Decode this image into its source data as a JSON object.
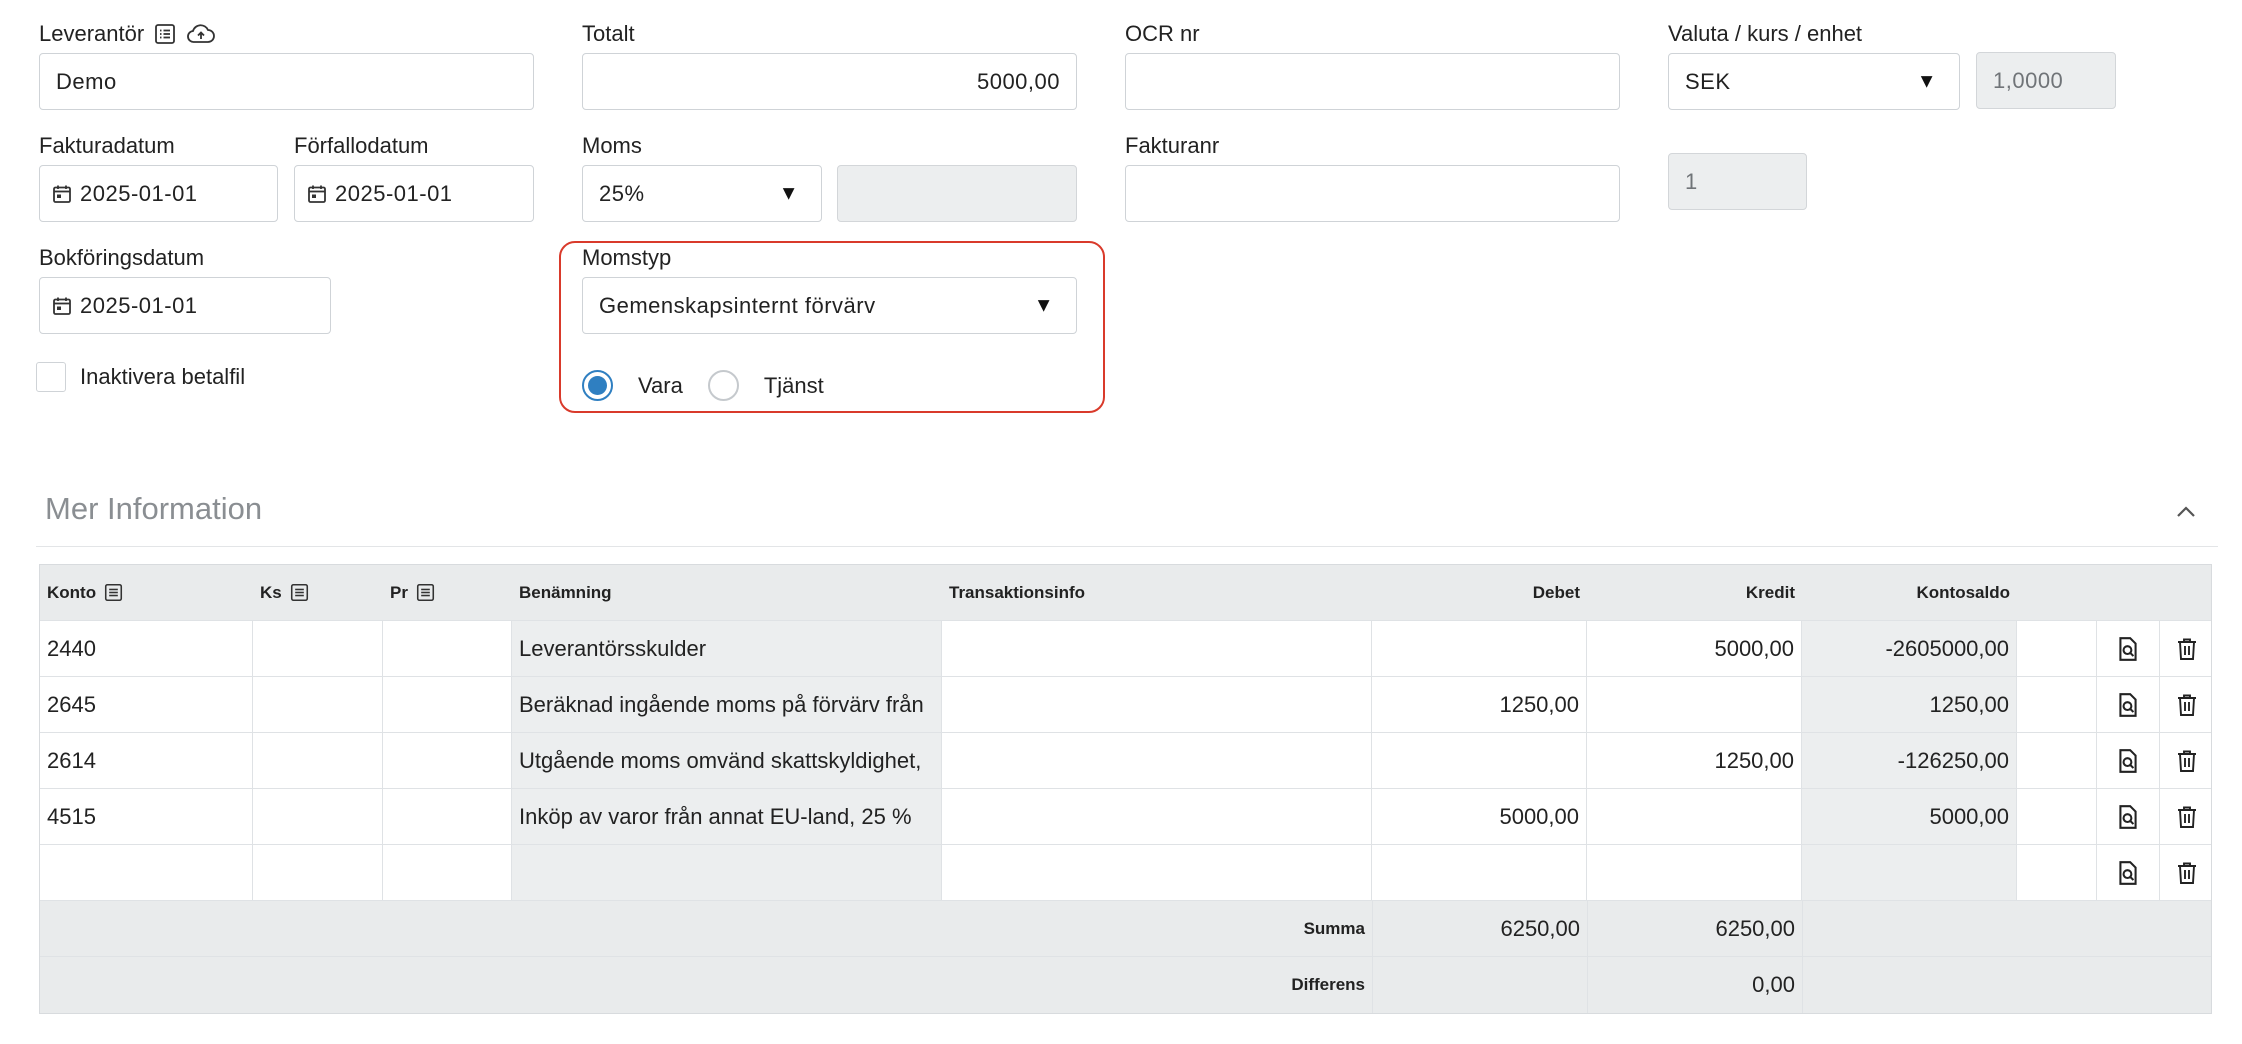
{
  "form": {
    "supplier": {
      "label": "Leverantör",
      "value": "Demo"
    },
    "total": {
      "label": "Totalt",
      "value": "5000,00"
    },
    "ocr": {
      "label": "OCR nr",
      "value": ""
    },
    "currency": {
      "label": "Valuta / kurs / enhet",
      "selected": "SEK",
      "rate": "1,0000",
      "unit": "1"
    },
    "invoice_date": {
      "label": "Fakturadatum",
      "value": "2025-01-01"
    },
    "due_date": {
      "label": "Förfallodatum",
      "value": "2025-01-01"
    },
    "vat": {
      "label": "Moms",
      "selected": "25%",
      "amount": ""
    },
    "invoice_no": {
      "label": "Fakturanr",
      "value": ""
    },
    "booking_date": {
      "label": "Bokföringsdatum",
      "value": "2025-01-01"
    },
    "vat_type": {
      "label": "Momstyp",
      "selected": "Gemenskapsinternt förvärv",
      "options": [
        "Vara",
        "Tjänst"
      ],
      "checked": "Vara"
    },
    "disable_payfile": {
      "label": "Inaktivera betalfil",
      "checked": false
    }
  },
  "more_info": {
    "title": "Mer Information"
  },
  "table": {
    "headers": [
      "Konto",
      "Ks",
      "Pr",
      "Benämning",
      "Transaktionsinfo",
      "Debet",
      "Kredit",
      "Kontosaldo"
    ],
    "rows": [
      {
        "konto": "2440",
        "ks": "",
        "pr": "",
        "benamning": "Leverantörsskulder",
        "info": "",
        "debet": "",
        "kredit": "5000,00",
        "saldo": "-2605000,00"
      },
      {
        "konto": "2645",
        "ks": "",
        "pr": "",
        "benamning": "Beräknad ingående moms på förvärv från",
        "info": "",
        "debet": "1250,00",
        "kredit": "",
        "saldo": "1250,00"
      },
      {
        "konto": "2614",
        "ks": "",
        "pr": "",
        "benamning": "Utgående moms omvänd skattskyldighet,",
        "info": "",
        "debet": "",
        "kredit": "1250,00",
        "saldo": "-126250,00"
      },
      {
        "konto": "4515",
        "ks": "",
        "pr": "",
        "benamning": "Inköp av varor från annat EU-land, 25 %",
        "info": "",
        "debet": "5000,00",
        "kredit": "",
        "saldo": "5000,00"
      },
      {
        "konto": "",
        "ks": "",
        "pr": "",
        "benamning": "",
        "info": "",
        "debet": "",
        "kredit": "",
        "saldo": ""
      }
    ],
    "summa": {
      "label": "Summa",
      "debet": "6250,00",
      "kredit": "6250,00"
    },
    "differens": {
      "label": "Differens",
      "value": "0,00"
    }
  },
  "icons": [
    "list-icon",
    "cloud-upload-icon",
    "calendar-icon",
    "caret-down-icon",
    "chevron-up-icon",
    "document-search-icon",
    "trash-icon"
  ],
  "colors": {
    "highlight": "#d93a2b",
    "radio": "#2f7fc1",
    "disabled": "#eceeef"
  }
}
